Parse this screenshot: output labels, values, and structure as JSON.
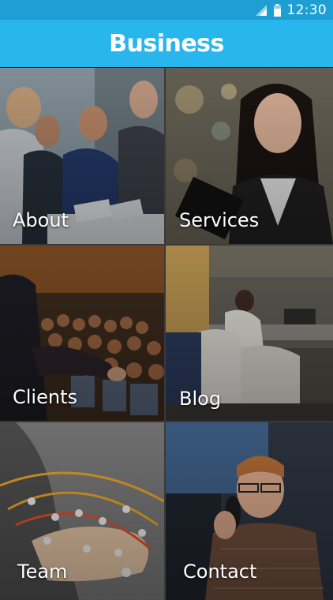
{
  "status_bar": {
    "time": "12:30",
    "icons": [
      "signal-icon",
      "battery-icon"
    ]
  },
  "app_bar": {
    "title": "Business",
    "color": "#29b6ec"
  },
  "tiles": [
    {
      "label": "About"
    },
    {
      "label": "Services"
    },
    {
      "label": "Clients"
    },
    {
      "label": "Blog"
    },
    {
      "label": "Team"
    },
    {
      "label": "Contact"
    }
  ],
  "colors": {
    "status_bar": "#1d9fd3",
    "accent": "#29b6ec"
  }
}
